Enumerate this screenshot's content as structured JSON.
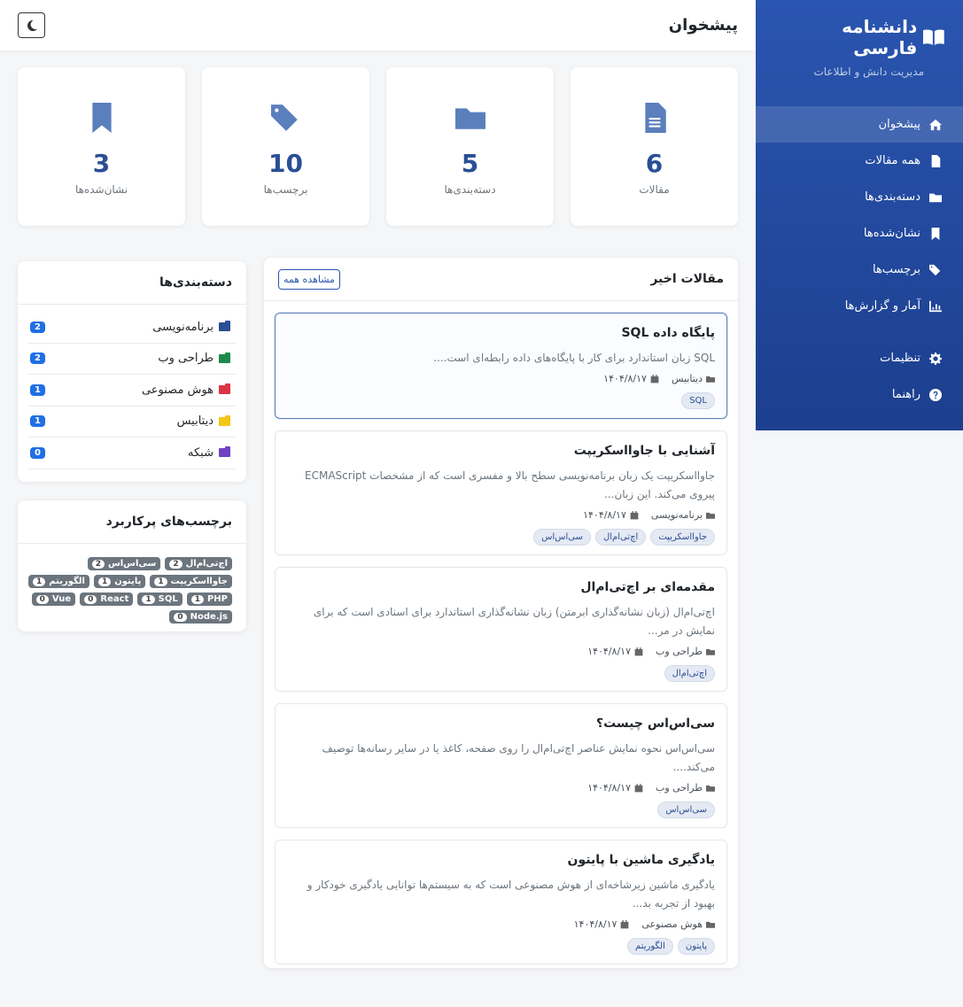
{
  "brand": {
    "title": "دانشنامه فارسی",
    "subtitle": "مدیریت دانش و اطلاعات"
  },
  "nav": [
    {
      "label": "پیشخوان",
      "icon": "home-icon",
      "active": true
    },
    {
      "label": "همه مقالات",
      "icon": "file-icon"
    },
    {
      "label": "دسته‌بندی‌ها",
      "icon": "folder-icon"
    },
    {
      "label": "نشان‌شده‌ها",
      "icon": "bookmark-icon"
    },
    {
      "label": "برچسب‌ها",
      "icon": "tags-icon"
    },
    {
      "label": "آمار و گزارش‌ها",
      "icon": "chart-icon"
    },
    {
      "label": "تنظیمات",
      "icon": "gear-icon"
    },
    {
      "label": "راهنما",
      "icon": "question-icon"
    }
  ],
  "header": {
    "title": "پیشخوان"
  },
  "stats": [
    {
      "value": "6",
      "label": "مقالات",
      "icon": "file-icon"
    },
    {
      "value": "5",
      "label": "دسته‌بندی‌ها",
      "icon": "folder-icon"
    },
    {
      "value": "10",
      "label": "برچسب‌ها",
      "icon": "tags-icon"
    },
    {
      "value": "3",
      "label": "نشان‌شده‌ها",
      "icon": "bookmark-icon"
    }
  ],
  "recent": {
    "title": "مقالات اخیر",
    "view_all": "مشاهده همه",
    "articles": [
      {
        "title": "پایگاه داده SQL",
        "excerpt": "SQL زبان استاندارد برای کار با پایگاه‌های داده رابطه‌ای است....",
        "category": "دیتابیس",
        "date": "۱۴۰۴/۸/۱۷",
        "tags": [
          "SQL"
        ]
      },
      {
        "title": "آشنایی با جاوااسکریپت",
        "excerpt": "جاوااسکریپت یک زبان برنامه‌نویسی سطح بالا و مفسری است که از مشخصات ECMAScript پیروی می‌کند. این زبان...",
        "category": "برنامه‌نویسی",
        "date": "۱۴۰۴/۸/۱۷",
        "tags": [
          "جاوااسکریپت",
          "اچ‌تی‌ام‌ال",
          "سی‌اس‌اس"
        ]
      },
      {
        "title": "مقدمه‌ای بر اچ‌تی‌ام‌ال",
        "excerpt": "اچ‌تی‌ام‌ال (زبان نشانه‌گذاری ابرمتن) زبان نشانه‌گذاری استاندارد برای اسنادی است که برای نمایش در مر...",
        "category": "طراحی وب",
        "date": "۱۴۰۴/۸/۱۷",
        "tags": [
          "اچ‌تی‌ام‌ال"
        ]
      },
      {
        "title": "سی‌اس‌اس چیست؟",
        "excerpt": "سی‌اس‌اس نحوه نمایش عناصر اچ‌تی‌ام‌ال را روی صفحه، کاغذ یا در سایر رسانه‌ها توصیف می‌کند....",
        "category": "طراحی وب",
        "date": "۱۴۰۴/۸/۱۷",
        "tags": [
          "سی‌اس‌اس"
        ]
      },
      {
        "title": "یادگیری ماشین با پایتون",
        "excerpt": "یادگیری ماشین زیرشاخه‌ای از هوش مصنوعی است که به سیستم‌ها توانایی یادگیری خودکار و بهبود از تجربه بد...",
        "category": "هوش مصنوعی",
        "date": "۱۴۰۴/۸/۱۷",
        "tags": [
          "پایتون",
          "الگوریتم"
        ]
      }
    ]
  },
  "categories": {
    "title": "دسته‌بندی‌ها",
    "items": [
      {
        "name": "برنامه‌نویسی",
        "count": "2",
        "color": "#2a4f94"
      },
      {
        "name": "طراحی وب",
        "count": "2",
        "color": "#1e8a4a"
      },
      {
        "name": "هوش مصنوعی",
        "count": "1",
        "color": "#dc3545"
      },
      {
        "name": "دیتابیس",
        "count": "1",
        "color": "#f5c518"
      },
      {
        "name": "شبکه",
        "count": "0",
        "color": "#6f42c1"
      }
    ]
  },
  "popular_tags": {
    "title": "برچسب‌های پرکاربرد",
    "items": [
      {
        "name": "اچ‌تی‌ام‌ال",
        "count": "2"
      },
      {
        "name": "سی‌اس‌اس",
        "count": "2"
      },
      {
        "name": "جاوااسکریپت",
        "count": "1"
      },
      {
        "name": "پایتون",
        "count": "1"
      },
      {
        "name": "الگوریتم",
        "count": "1"
      },
      {
        "name": "PHP",
        "count": "1"
      },
      {
        "name": "SQL",
        "count": "1"
      },
      {
        "name": "React",
        "count": "0"
      },
      {
        "name": "Vue",
        "count": "0"
      },
      {
        "name": "Node.js",
        "count": "0"
      }
    ]
  }
}
